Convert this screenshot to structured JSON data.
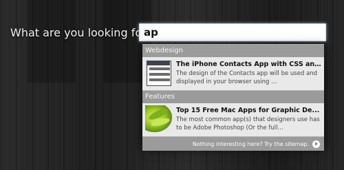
{
  "search": {
    "label": "What are you looking for?",
    "value": "ap"
  },
  "dropdown": {
    "categories": [
      {
        "name": "Webdesign",
        "result": {
          "title": "The iPhone Contacts App with CSS an...",
          "description": "The design of the Contacts app will be used and displayed in your browser using ...",
          "thumb_icon": "iphone-contacts-thumbnail"
        }
      },
      {
        "name": "Features",
        "result": {
          "title": "Top 15 Free Mac Apps for Graphic De...",
          "description": "The most common app(s) that designers use has to be Adobe Photoshop (Or the full...",
          "thumb_icon": "green-leaf-thumbnail"
        }
      }
    ],
    "footer_text": "Nothing interesting here? Try the sitemap.",
    "footer_icon": "arrow-right-circle-icon"
  },
  "colors": {
    "background": "#262626",
    "category_header": "#9b9b9b",
    "result_bg": "#e9e9e9"
  }
}
